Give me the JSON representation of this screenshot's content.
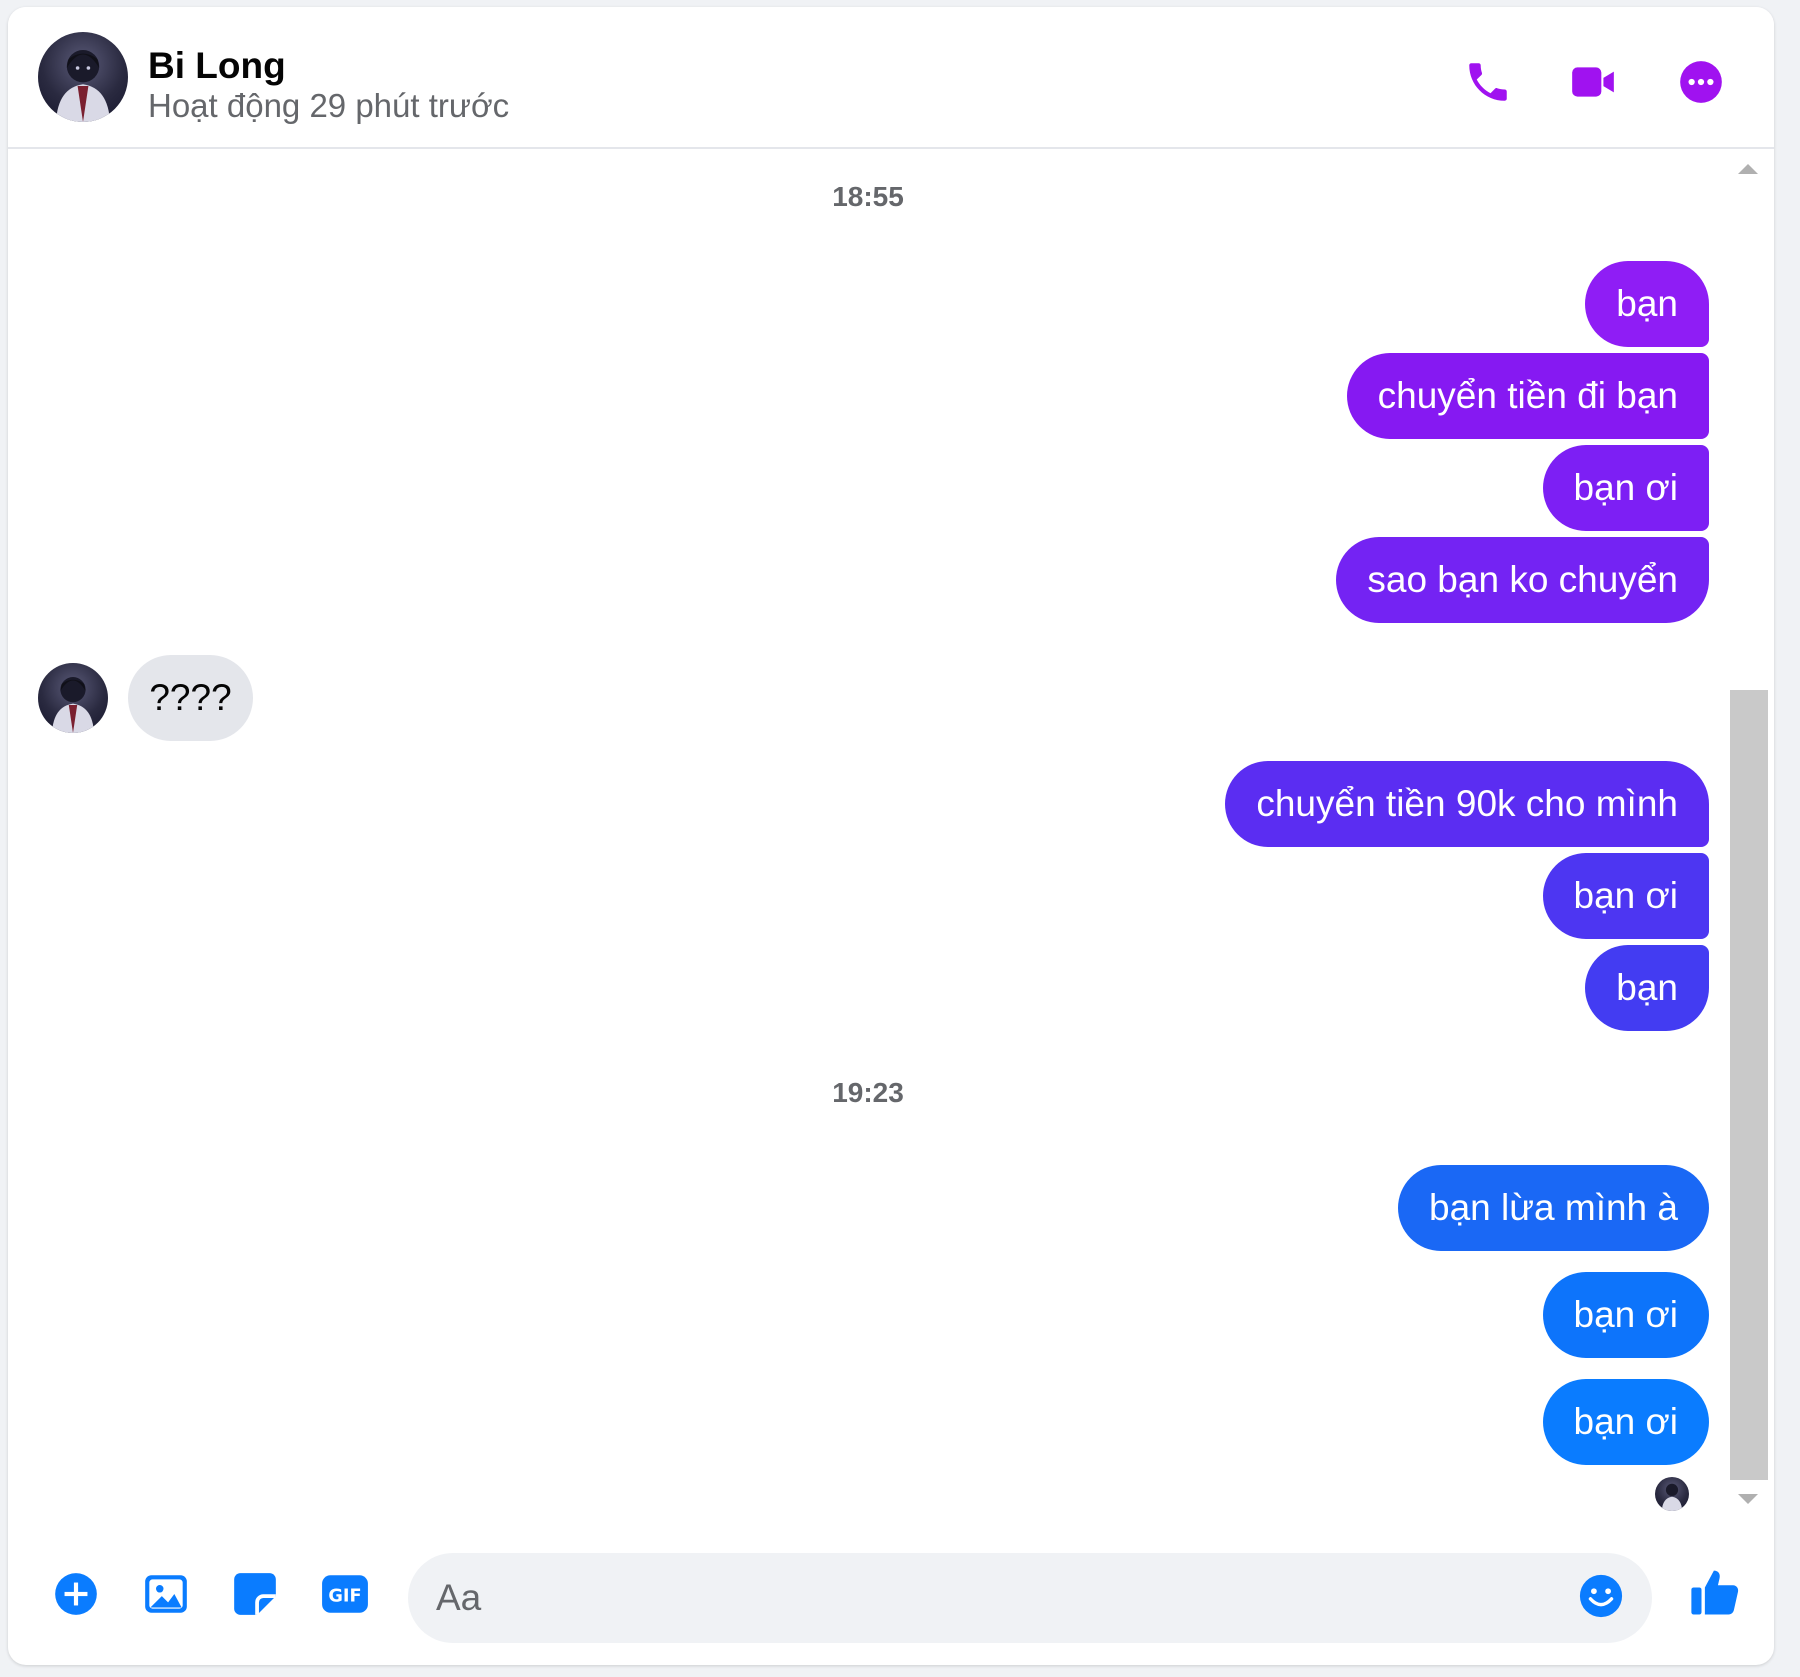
{
  "header": {
    "contact_name": "Bi Long",
    "status": "Hoạt động 29 phút trước",
    "accent_color": "#a012f0",
    "icons": [
      "phone-icon",
      "video-call-icon",
      "more-options-icon"
    ]
  },
  "messages": {
    "group1_time": "18:55",
    "outgoing1": [
      "bạn",
      "chuyển tiền đi bạn",
      "bạn ơi",
      "sao bạn ko chuyển"
    ],
    "incoming1": "????",
    "outgoing2": [
      "chuyển tiền 90k cho mình",
      "bạn ơi",
      "bạn"
    ],
    "group2_time": "19:23",
    "outgoing3": [
      "bạn lừa mình à",
      "bạn ơi",
      "bạn ơi"
    ]
  },
  "composer": {
    "placeholder": "Aa",
    "accent_color": "#0a7cff",
    "icons": [
      "plus-circle-icon",
      "image-icon",
      "sticker-icon",
      "gif-icon",
      "emoji-icon",
      "thumbs-up-icon"
    ]
  },
  "colors": {
    "gradient_top": "#8f1df5",
    "gradient_mid": "#5b2df2",
    "gradient_bottom": "#0a7cff",
    "incoming_bg": "#e4e6eb"
  }
}
